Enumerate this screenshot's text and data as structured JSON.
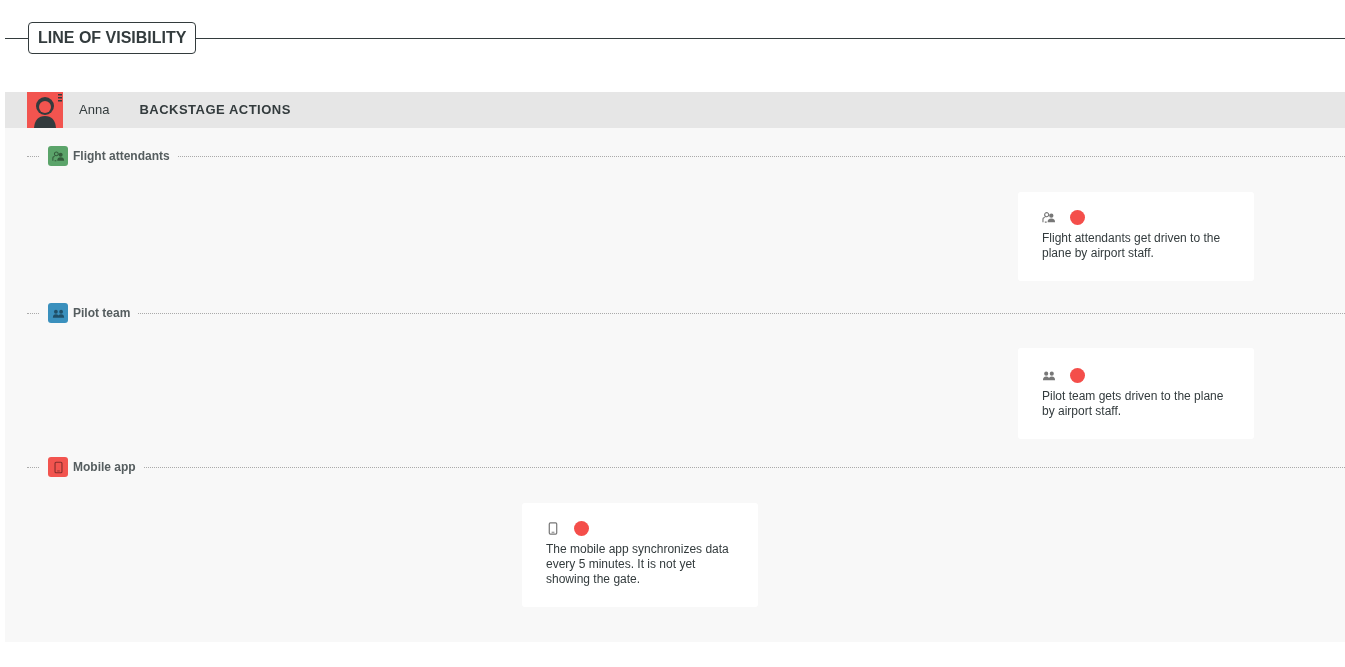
{
  "section_title": "LINE OF VISIBILITY",
  "header": {
    "persona": "Anna",
    "title": "BACKSTAGE ACTIONS"
  },
  "lanes": [
    {
      "label": "Flight attendants",
      "kind": "staff",
      "color": "#5ba46a",
      "cards": [
        {
          "kind": "staff",
          "text": "Flight attendants get driven to the plane by airport staff."
        }
      ]
    },
    {
      "label": "Pilot team",
      "kind": "team",
      "color": "#3a90bd",
      "cards": [
        {
          "kind": "team",
          "text": "Pilot team gets driven to the plane by airport staff."
        }
      ]
    },
    {
      "label": "Mobile app",
      "kind": "device",
      "color": "#f2544f",
      "cards": [
        {
          "kind": "device",
          "text": "The mobile app synchronizes data every 5 minutes. It is not yet showing the gate."
        }
      ]
    }
  ]
}
